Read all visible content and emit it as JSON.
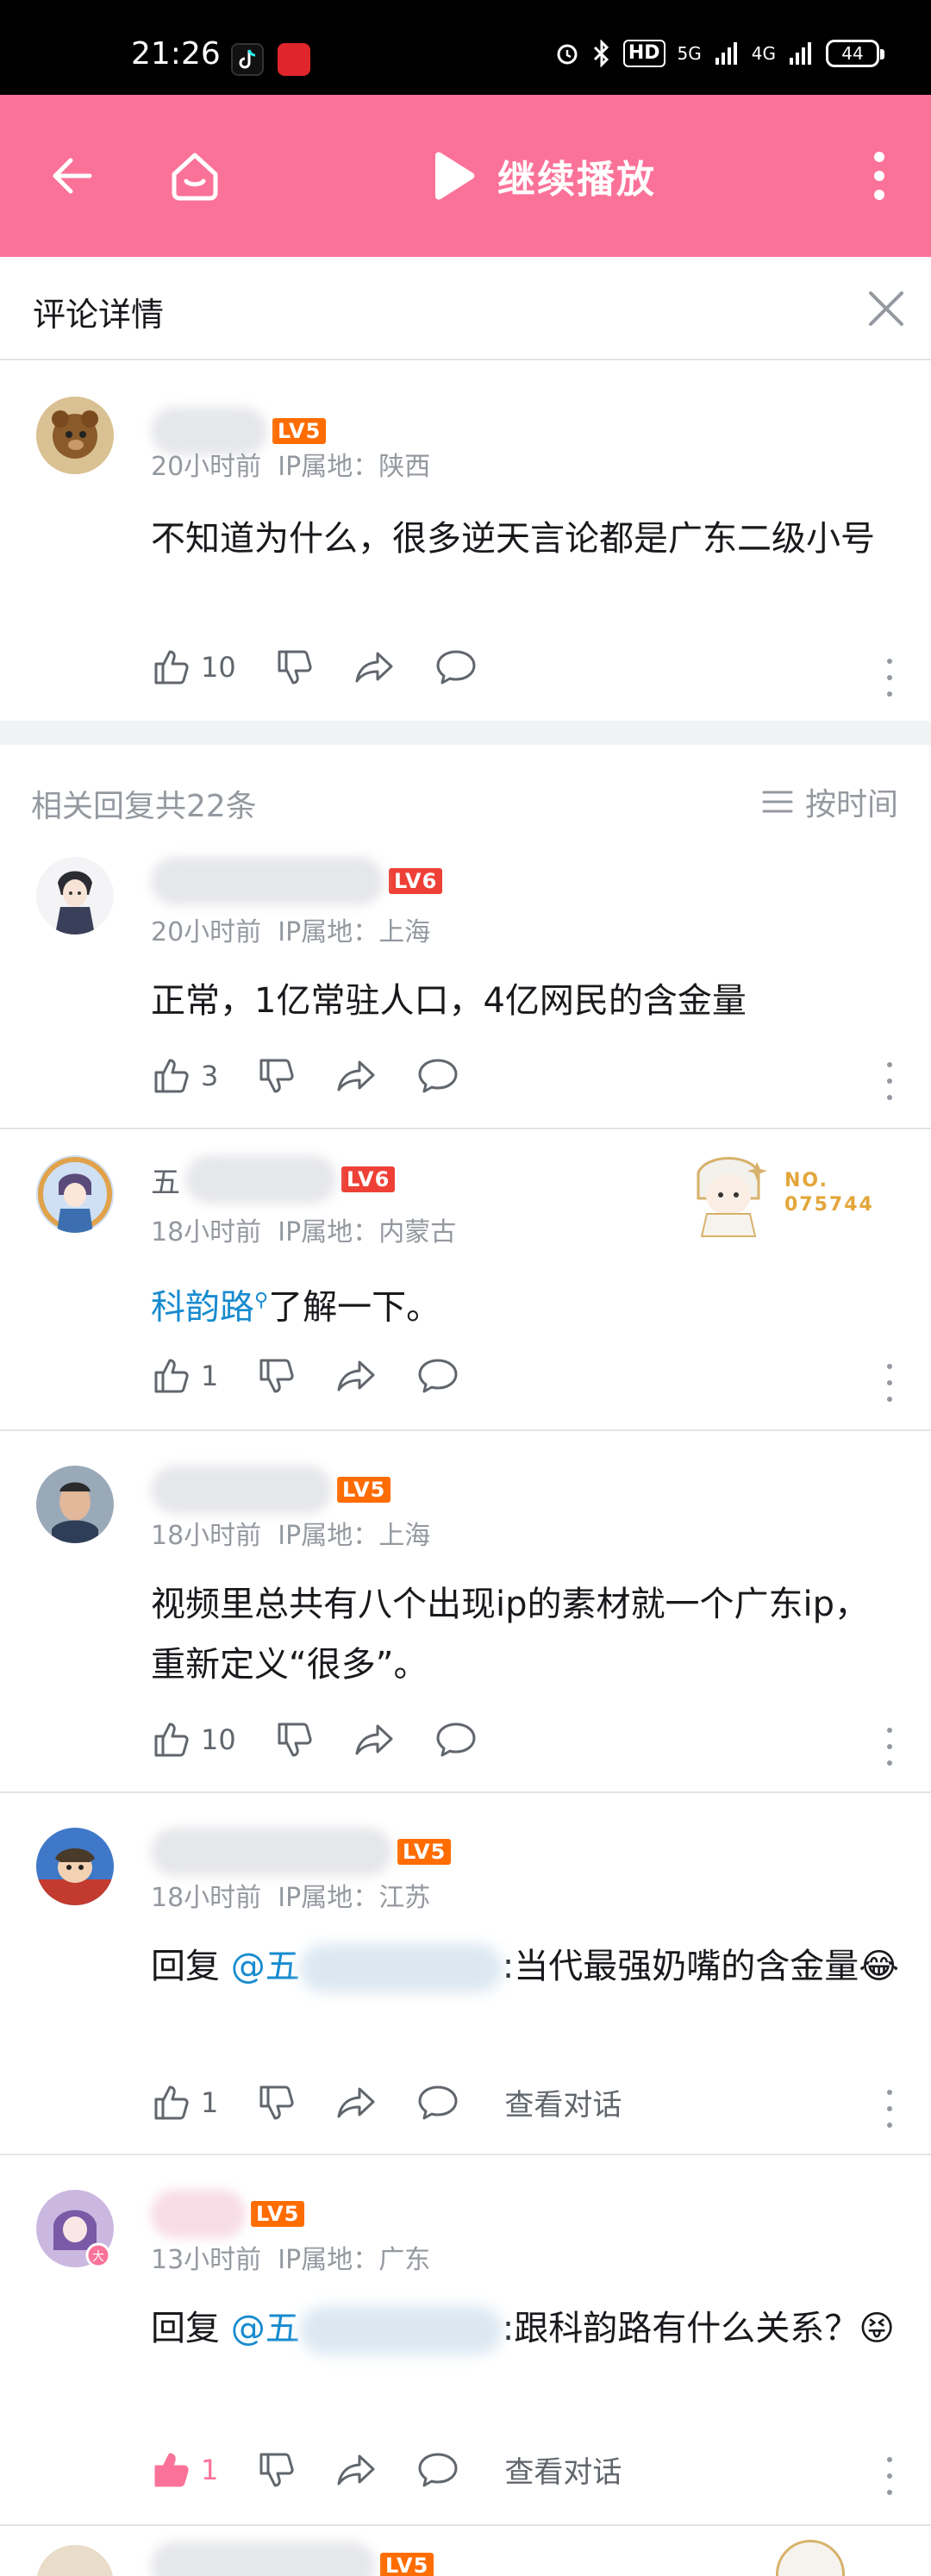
{
  "status_bar": {
    "time": "21:26",
    "hd": "HD",
    "net_5g": "5G",
    "net_4g": "4G",
    "battery": "44"
  },
  "topbar": {
    "play_label": "继续播放"
  },
  "detail": {
    "title": "评论详情"
  },
  "main_comment": {
    "level": "LV5",
    "time": "20小时前",
    "ip": "IP属地：陕西",
    "text": "不知道为什么，很多逆天言论都是广东二级小号",
    "likes": "10"
  },
  "replies_header": {
    "count": "相关回复共22条",
    "sort": "按时间"
  },
  "replies": [
    {
      "name_prefix": "",
      "level": "LV6",
      "time": "20小时前",
      "ip": "IP属地：上海",
      "text": "正常，1亿常驻人口，4亿网民的含金量",
      "likes": "3"
    },
    {
      "name_prefix": "五",
      "level": "LV6",
      "time": "18小时前",
      "ip": "IP属地：内蒙古",
      "link_text": "科韵路",
      "text": "了解一下。",
      "likes": "1",
      "badge_no": "NO.\n075744"
    },
    {
      "name_prefix": "",
      "level": "LV5",
      "time": "18小时前",
      "ip": "IP属地：上海",
      "text": "视频里总共有八个出现ip的素材就一个广东ip，重新定义“很多”。",
      "likes": "10"
    },
    {
      "name_prefix": "",
      "level": "LV5",
      "time": "18小时前",
      "ip": "IP属地：江苏",
      "reply_prefix": "回复 ",
      "at_name": "@五",
      "text": ":当代最强奶嘴的含金量😂",
      "likes": "1",
      "dialog": "查看对话"
    },
    {
      "name_prefix": "",
      "level": "LV5",
      "time": "13小时前",
      "ip": "IP属地：广东",
      "reply_prefix": "回复 ",
      "at_name": "@五",
      "text": ":跟科韵路有什么关系？😝",
      "likes": "1",
      "dialog": "查看对话"
    }
  ],
  "partial": {
    "level": "LV5"
  },
  "icons": {
    "back": "back-arrow-icon",
    "home": "home-icon",
    "play": "play-icon",
    "more": "more-vertical-icon",
    "close": "close-icon",
    "like": "thumbs-up-icon",
    "dislike": "thumbs-down-icon",
    "share": "share-icon",
    "comment": "comment-bubble-icon",
    "sort": "sort-lines-icon"
  },
  "colors": {
    "brand_pink": "#fb7299",
    "link_blue": "#178bcf",
    "level_orange": "#ff6c00",
    "level_red": "#ee4036"
  }
}
